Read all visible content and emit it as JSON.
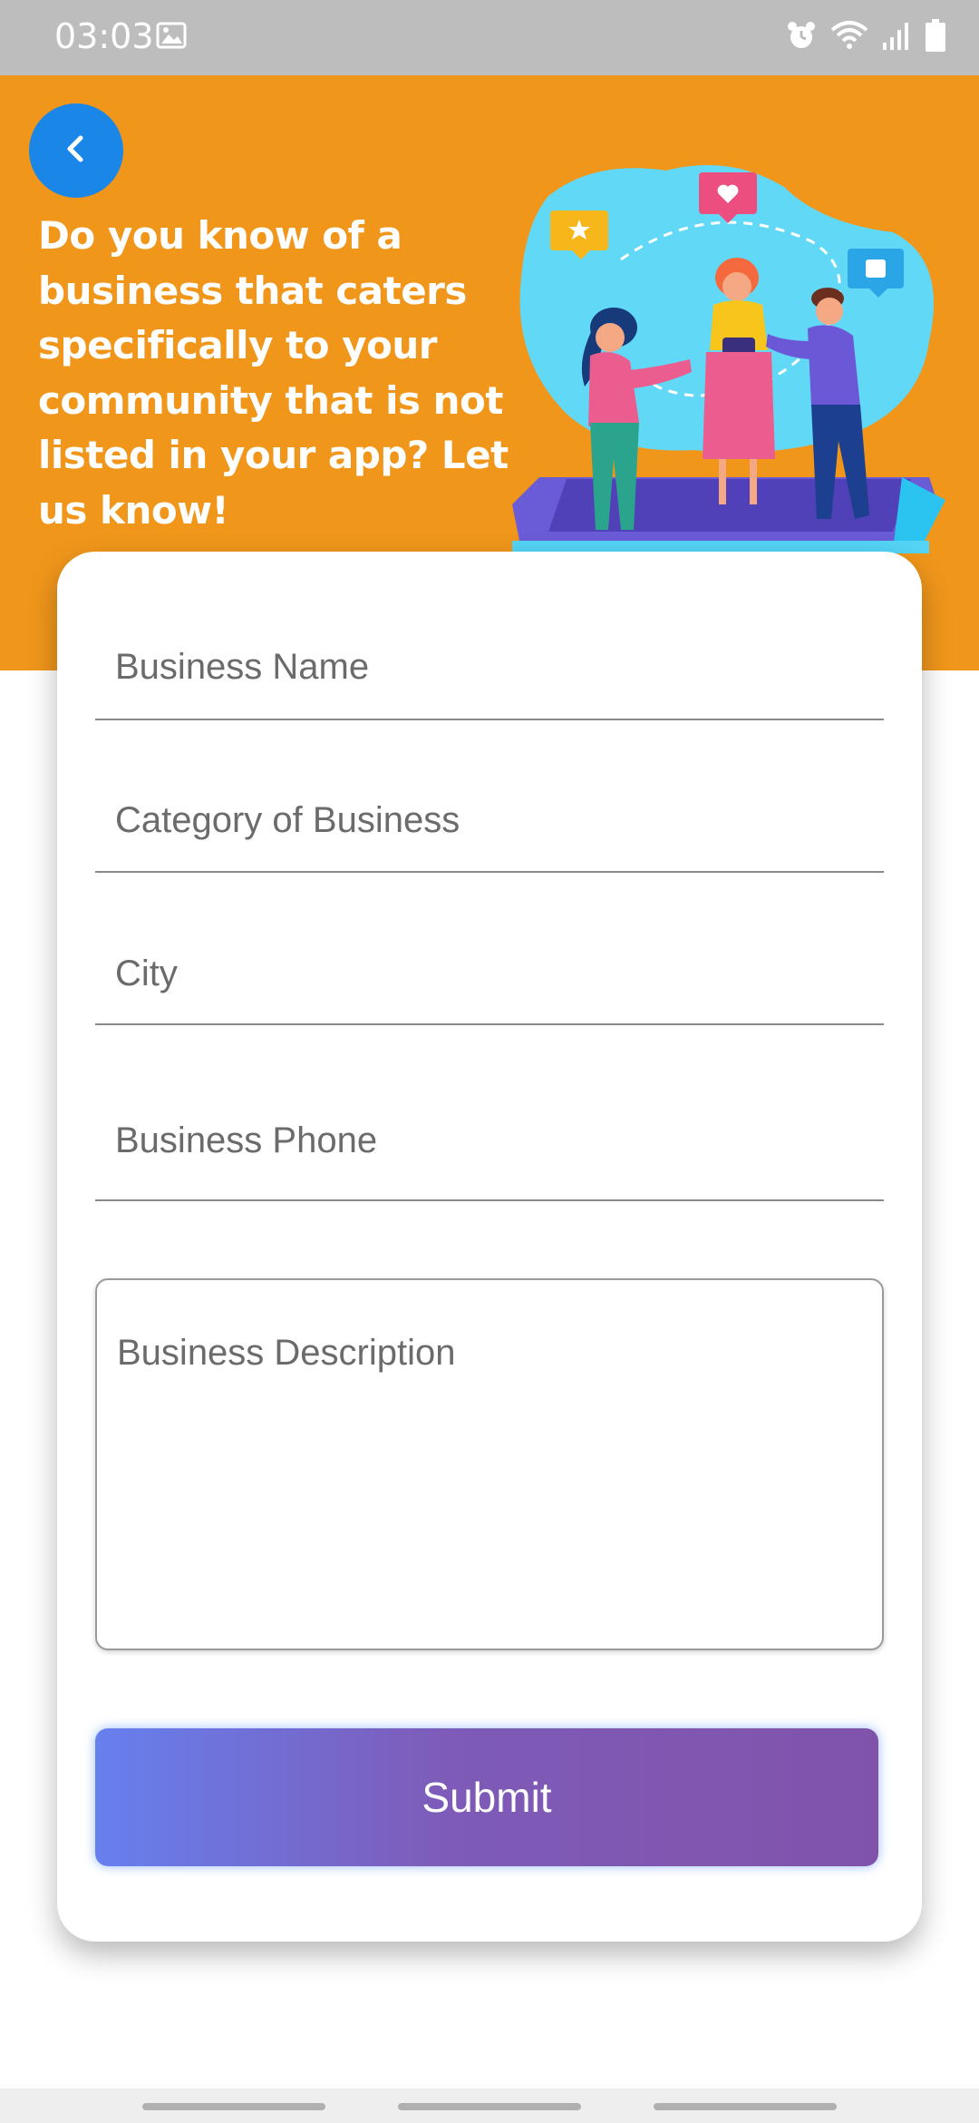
{
  "status_bar": {
    "time": "03:03",
    "icons": [
      "image-icon",
      "alarm-icon",
      "wifi-icon",
      "signal-icon",
      "battery-icon"
    ]
  },
  "header": {
    "back_icon": "chevron-left-icon",
    "text": "Do you know of a business that caters specifically to your community that is not listed in your app? Let us know!",
    "colors": {
      "background": "#f0961b",
      "back_button": "#1a86e8"
    }
  },
  "form": {
    "business_name": {
      "placeholder": "Business Name",
      "value": ""
    },
    "category": {
      "placeholder": "Category of Business",
      "value": ""
    },
    "city": {
      "placeholder": "City",
      "value": ""
    },
    "phone": {
      "placeholder": "Business Phone",
      "value": ""
    },
    "description": {
      "placeholder": "Business Description",
      "value": ""
    },
    "submit_label": "Submit"
  }
}
